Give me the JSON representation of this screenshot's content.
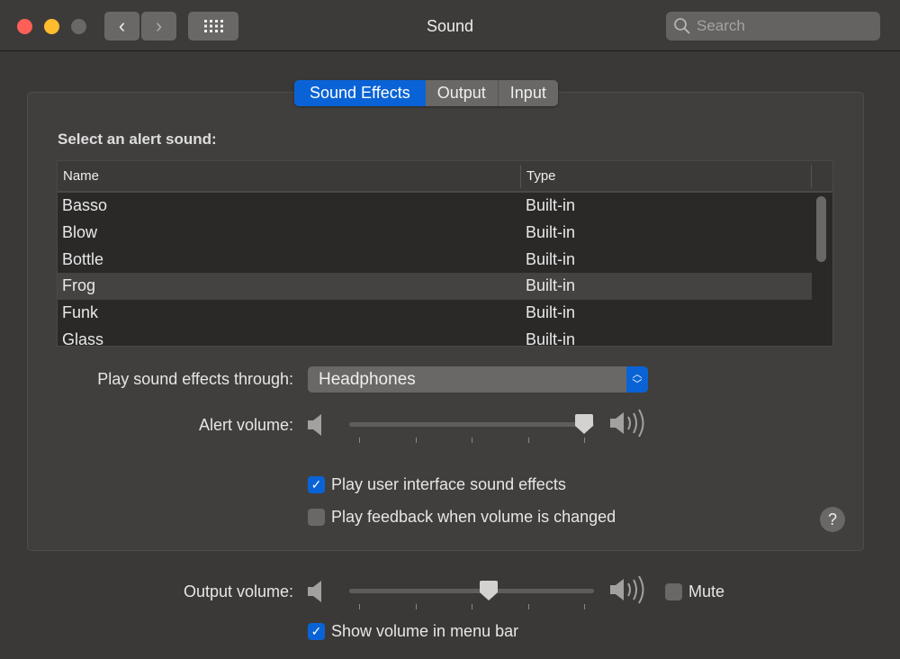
{
  "window": {
    "title": "Sound",
    "search_placeholder": "Search"
  },
  "colors": {
    "accent": "#0a63d6",
    "close": "#fe5f57",
    "minimize": "#febc2e",
    "zoom_disabled": "#6a6866"
  },
  "tabs": [
    {
      "label": "Sound Effects",
      "active": true
    },
    {
      "label": "Output",
      "active": false
    },
    {
      "label": "Input",
      "active": false
    }
  ],
  "sound_effects": {
    "heading": "Select an alert sound:",
    "columns": [
      "Name",
      "Type"
    ],
    "rows": [
      {
        "name": "Basso",
        "type": "Built-in"
      },
      {
        "name": "Blow",
        "type": "Built-in"
      },
      {
        "name": "Bottle",
        "type": "Built-in"
      },
      {
        "name": "Frog",
        "type": "Built-in",
        "selected": true
      },
      {
        "name": "Funk",
        "type": "Built-in"
      },
      {
        "name": "Glass",
        "type": "Built-in"
      }
    ],
    "play_through_label": "Play sound effects through:",
    "play_through_value": "Headphones",
    "alert_volume_label": "Alert volume:",
    "alert_volume": 0.96,
    "ui_sounds_label": "Play user interface sound effects",
    "ui_sounds_checked": true,
    "feedback_label": "Play feedback when volume is changed",
    "feedback_checked": false,
    "help": "?"
  },
  "output_volume_label": "Output volume:",
  "output_volume": 0.57,
  "mute_label": "Mute",
  "mute_checked": false,
  "show_in_menu_label": "Show volume in menu bar",
  "show_in_menu_checked": true
}
